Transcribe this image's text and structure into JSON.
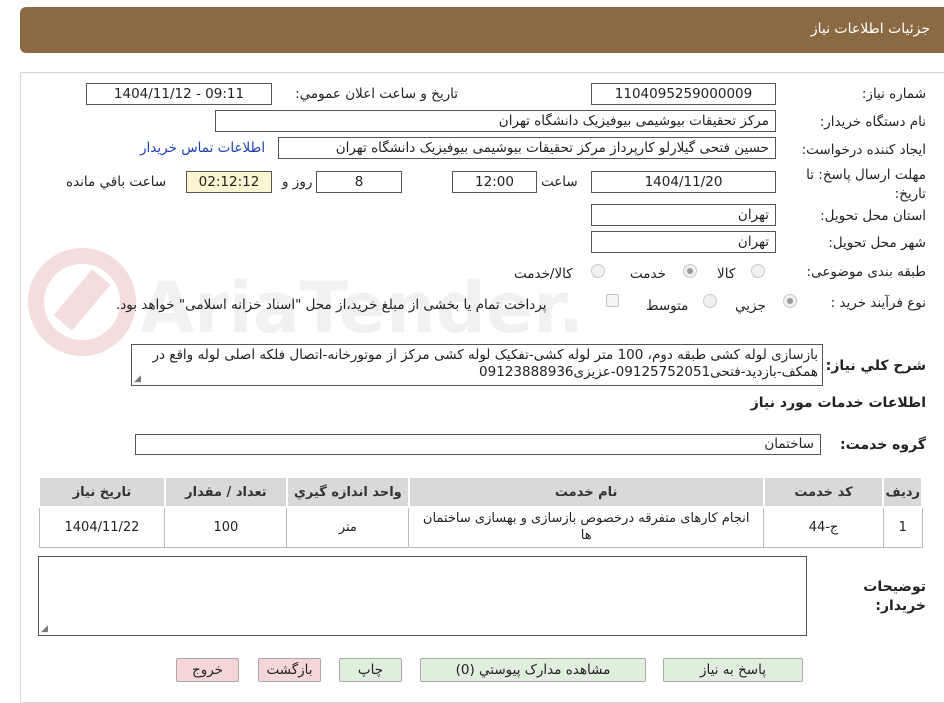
{
  "header": {
    "title": "جزئیات اطلاعات نیاز"
  },
  "fields": {
    "need_number_label": "شماره نیاز:",
    "need_number": "1104095259000009",
    "announce_label": "تاریخ و ساعت اعلان عمومي:",
    "announce_value": "1404/11/12 - 09:11",
    "buyer_org_label": "نام دستگاه خريدار:",
    "buyer_org": "مرکز تحقیقات بیوشیمی بیوفیزیک دانشگاه تهران",
    "requester_label": "ايجاد کننده درخواست:",
    "requester": "حسین فتحی گیلارلو کارپرداز مرکز تحقیقات بیوشیمی بیوفیزیک دانشگاه تهران",
    "contact_link": "اطلاعات تماس خریدار",
    "deadline_label": "مهلت ارسال پاسخ: تا تاريخ:",
    "deadline_date": "1404/11/20",
    "time_label": "ساعت",
    "deadline_time": "12:00",
    "days_value": "8",
    "days_label": "روز و",
    "remaining_time": "02:12:12",
    "remaining_label": "ساعت باقي مانده",
    "province_label": "استان محل تحويل:",
    "province": "تهران",
    "city_label": "شهر محل تحويل:",
    "city": "تهران",
    "category_label": "طبقه بندی موضوعی:",
    "category_options": [
      "کالا",
      "خدمت",
      "کالا/خدمت"
    ],
    "process_label": "نوع فرآيند خريد :",
    "process_options": [
      "جزيي",
      "متوسط"
    ],
    "payment_note": "پرداخت تمام یا بخشی از مبلغ خرید،از محل \"اسناد خزانه اسلامی\" خواهد بود."
  },
  "description": {
    "label": "شرح کلي نياز:",
    "text": "بازسازی لوله کشی طبقه دوم، 100 متر لوله کشی-تفکیک لوله کشی مرکز از موتورخانه-اتصال فلکه اصلی لوله واقع در همکف-بازدید-فتحی09125752051-عزیزی09123888936"
  },
  "services": {
    "section_title": "اطلاعات خدمات مورد نياز",
    "group_label": "گروه خدمت:",
    "group_value": "ساختمان",
    "columns": [
      "رديف",
      "کد خدمت",
      "نام خدمت",
      "واحد اندازه گيري",
      "تعداد / مقدار",
      "تاريخ نياز"
    ],
    "rows": [
      {
        "row": "1",
        "code": "ج-44",
        "name": "انجام کارهای متفرقه درخصوص بازسازی و بهسازی ساختمان ها",
        "unit": "متر",
        "qty": "100",
        "date": "1404/11/22"
      }
    ]
  },
  "buyer_notes": {
    "label": "توضيحات خريدار:",
    "value": ""
  },
  "buttons": {
    "reply": "پاسخ به نياز",
    "attachments": "مشاهده مدارک پيوستي (0)",
    "print": "چاپ",
    "back": "بازگشت",
    "exit": "خروج"
  },
  "watermark_text": "AriaTender.neT"
}
